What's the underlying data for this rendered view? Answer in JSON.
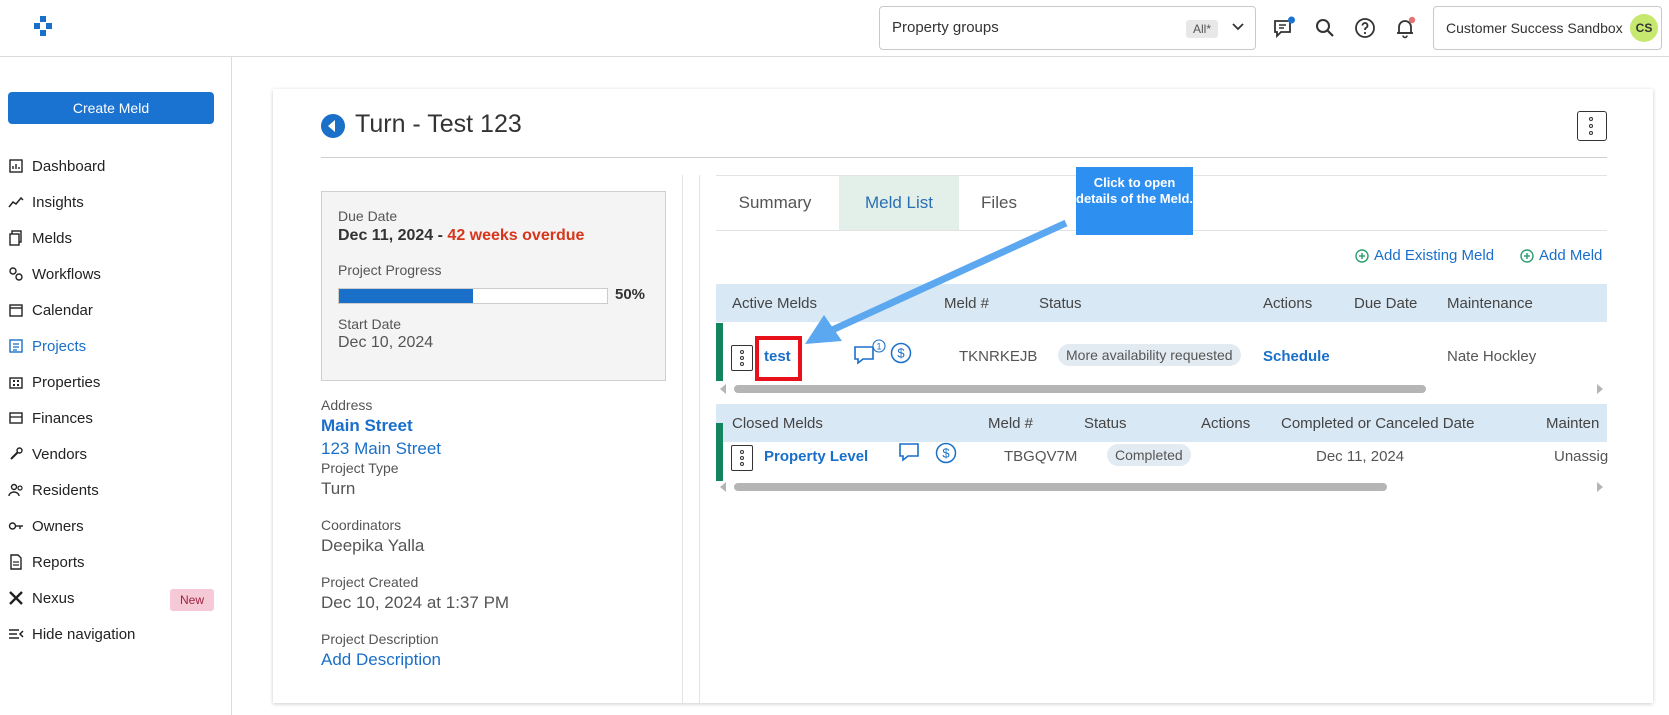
{
  "topbar": {
    "property_groups_label": "Property groups",
    "property_groups_badge": "All*",
    "org_name": "Customer Success Sandbox",
    "avatar_initials": "CS",
    "accent": "#1a73d1"
  },
  "sidebar": {
    "create_label": "Create Meld",
    "items": [
      {
        "label": "Dashboard",
        "icon": "dashboard-icon"
      },
      {
        "label": "Insights",
        "icon": "insights-icon"
      },
      {
        "label": "Melds",
        "icon": "melds-icon"
      },
      {
        "label": "Workflows",
        "icon": "workflows-icon"
      },
      {
        "label": "Calendar",
        "icon": "calendar-icon"
      },
      {
        "label": "Projects",
        "icon": "projects-icon"
      },
      {
        "label": "Properties",
        "icon": "properties-icon"
      },
      {
        "label": "Finances",
        "icon": "finances-icon"
      },
      {
        "label": "Vendors",
        "icon": "vendors-icon"
      },
      {
        "label": "Residents",
        "icon": "residents-icon"
      },
      {
        "label": "Owners",
        "icon": "owners-icon"
      },
      {
        "label": "Reports",
        "icon": "reports-icon"
      },
      {
        "label": "Nexus",
        "icon": "nexus-icon"
      },
      {
        "label": "Hide navigation",
        "icon": "hide-navigation-icon"
      }
    ],
    "active_item": "Projects",
    "nexus_badge": "New"
  },
  "project": {
    "title": "Turn - Test 123",
    "due_date_label": "Due Date",
    "due_date": "Dec 11, 2024",
    "due_sep": " - ",
    "overdue": "42 weeks overdue",
    "progress_label": "Project Progress",
    "progress_percent": 50,
    "progress_text": "50%",
    "start_date_label": "Start Date",
    "start_date": "Dec 10, 2024",
    "address_label": "Address",
    "address_name": "Main Street",
    "address_line": "123 Main Street",
    "type_label": "Project Type",
    "type_value": "Turn",
    "coordinators_label": "Coordinators",
    "coordinators_value": "Deepika Yalla",
    "created_label": "Project Created",
    "created_value": "Dec 10, 2024 at 1:37 PM",
    "description_label": "Project Description",
    "description_link": "Add Description"
  },
  "tabs": [
    "Summary",
    "Meld List",
    "Files"
  ],
  "active_tab": "Meld List",
  "actions": {
    "add_existing": "Add Existing Meld",
    "add_meld": "Add Meld"
  },
  "active_melds": {
    "columns": [
      "Active Melds",
      "Meld #",
      "Status",
      "Actions",
      "Due Date",
      "Maintenance"
    ],
    "rows": [
      {
        "title": "test",
        "message_count": "1",
        "meld_number": "TKNRKEJB",
        "status": "More availability requested",
        "action": "Schedule",
        "due_date": "",
        "maintenance": "Nate Hockley"
      }
    ]
  },
  "closed_melds": {
    "columns": [
      "Closed Melds",
      "Meld #",
      "Status",
      "Actions",
      "Completed or Canceled Date",
      "Mainten"
    ],
    "rows": [
      {
        "title": "Property Level",
        "meld_number": "TBGQV7M",
        "status": "Completed",
        "completed_date": "Dec 11, 2024",
        "maintenance": "Unassig"
      }
    ]
  },
  "callout": {
    "text": "Click to open details of the Meld."
  }
}
